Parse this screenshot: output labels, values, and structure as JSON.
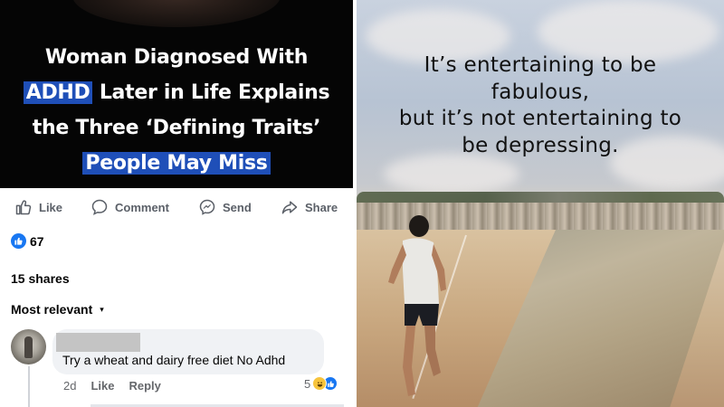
{
  "article": {
    "headline_line1": "Woman Diagnosed With",
    "headline_hl1": "ADHD",
    "headline_line2_rest": " Later in Life Explains",
    "headline_line3": "the Three ‘Defining Traits’",
    "headline_hl2": "People May Miss"
  },
  "actions": {
    "like": "Like",
    "comment": "Comment",
    "send": "Send",
    "share": "Share"
  },
  "stats": {
    "reactions": "67",
    "shares": "15 shares"
  },
  "comments_sort": {
    "label": "Most relevant"
  },
  "comment": {
    "text": "Try a wheat  and dairy free diet  No Adhd",
    "time": "2d",
    "like_label": "Like",
    "reply_label": "Reply",
    "reaction_count": "5"
  },
  "quote": {
    "line1": "It’s entertaining to be",
    "line2": "fabulous,",
    "line3": "but it’s not entertaining to",
    "line4": "be depressing."
  },
  "colors": {
    "facebook_blue": "#1877f2",
    "highlight_blue": "#1f4fb8"
  }
}
